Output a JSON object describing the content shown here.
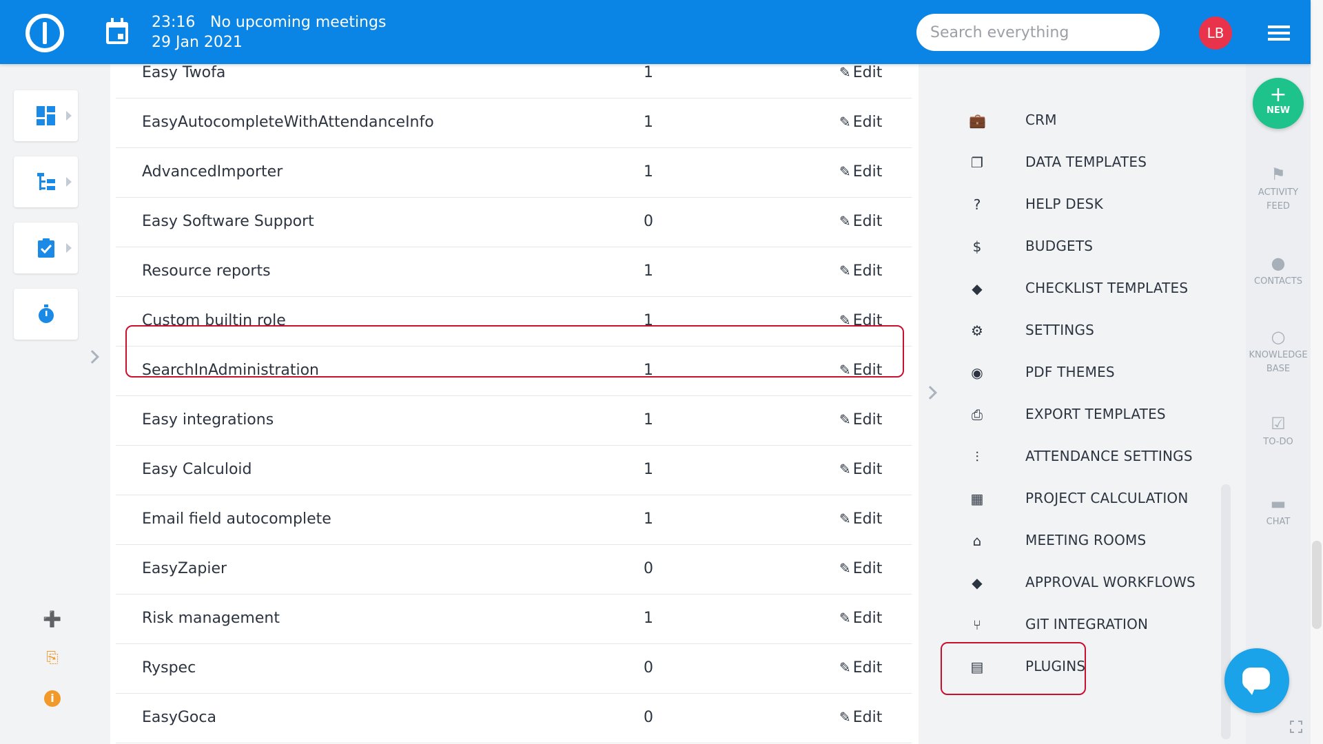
{
  "header": {
    "time": "23:16",
    "meetings": "No upcoming meetings",
    "date": "29 Jan 2021",
    "search_placeholder": "Search everything",
    "avatar_initials": "LB"
  },
  "plugins_table": {
    "edit_label": "Edit",
    "rows": [
      {
        "name": "Easy Twofa",
        "count": "1"
      },
      {
        "name": "EasyAutocompleteWithAttendanceInfo",
        "count": "1"
      },
      {
        "name": "AdvancedImporter",
        "count": "1"
      },
      {
        "name": "Easy Software Support",
        "count": "0"
      },
      {
        "name": "Resource reports",
        "count": "1"
      },
      {
        "name": "Custom builtin role",
        "count": "1"
      },
      {
        "name": "SearchInAdministration",
        "count": "1"
      },
      {
        "name": "Easy integrations",
        "count": "1"
      },
      {
        "name": "Easy Calculoid",
        "count": "1"
      },
      {
        "name": "Email field autocomplete",
        "count": "1"
      },
      {
        "name": "EasyZapier",
        "count": "0"
      },
      {
        "name": "Risk management",
        "count": "1"
      },
      {
        "name": "Ryspec",
        "count": "0"
      },
      {
        "name": "EasyGoca",
        "count": "0"
      }
    ]
  },
  "admin_menu": [
    {
      "label": "CRM",
      "icon": "briefcase-icon"
    },
    {
      "label": "DATA TEMPLATES",
      "icon": "copy-icon"
    },
    {
      "label": "HELP DESK",
      "icon": "help-icon"
    },
    {
      "label": "BUDGETS",
      "icon": "money-icon"
    },
    {
      "label": "CHECKLIST TEMPLATES",
      "icon": "diamond-arrow-icon"
    },
    {
      "label": "SETTINGS",
      "icon": "gear-icon"
    },
    {
      "label": "PDF THEMES",
      "icon": "eye-icon"
    },
    {
      "label": "EXPORT TEMPLATES",
      "icon": "printer-icon"
    },
    {
      "label": "ATTENDANCE SETTINGS",
      "icon": "sliders-icon"
    },
    {
      "label": "PROJECT CALCULATION",
      "icon": "calculator-icon"
    },
    {
      "label": "MEETING ROOMS",
      "icon": "home-icon"
    },
    {
      "label": "APPROVAL WORKFLOWS",
      "icon": "diamond-arrow-icon"
    },
    {
      "label": "GIT INTEGRATION",
      "icon": "git-branch-icon"
    },
    {
      "label": "PLUGINS",
      "icon": "plugin-icon"
    }
  ],
  "right_rail": {
    "new_label": "NEW",
    "items": [
      {
        "label_1": "ACTIVITY",
        "label_2": "FEED",
        "icon": "flag-icon"
      },
      {
        "label_1": "CONTACTS",
        "label_2": "",
        "icon": "person-icon"
      },
      {
        "label_1": "KNOWLEDGE",
        "label_2": "BASE",
        "icon": "lightbulb-icon"
      },
      {
        "label_1": "TO-DO",
        "label_2": "",
        "icon": "clipboard-check-icon"
      },
      {
        "label_1": "CHAT",
        "label_2": "",
        "icon": "chat-icon"
      }
    ]
  },
  "colors": {
    "topbar": "#0a84e5",
    "highlight": "#c8102e",
    "new_button": "#1ec28b",
    "avatar": "#e8334b",
    "accent_orange": "#f19a2b"
  }
}
